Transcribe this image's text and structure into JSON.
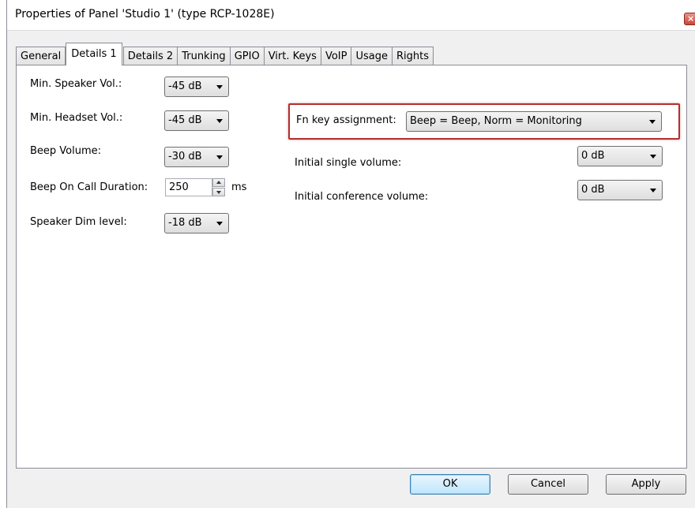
{
  "window": {
    "title": "Properties of Panel 'Studio 1' (type RCP-1028E)",
    "close_icon": "close-icon",
    "accent": "#c8473b"
  },
  "tabs": [
    {
      "label": "General",
      "active": false
    },
    {
      "label": "Details 1",
      "active": true
    },
    {
      "label": "Details 2",
      "active": false
    },
    {
      "label": "Trunking",
      "active": false
    },
    {
      "label": "GPIO",
      "active": false
    },
    {
      "label": "Virt. Keys",
      "active": false
    },
    {
      "label": "VoIP",
      "active": false
    },
    {
      "label": "Usage",
      "active": false
    },
    {
      "label": "Rights",
      "active": false
    }
  ],
  "left": {
    "min_speaker_vol": {
      "label": "Min. Speaker Vol.:",
      "value": "-45 dB"
    },
    "min_headset_vol": {
      "label": "Min. Headset Vol.:",
      "value": "-45 dB"
    },
    "beep_volume": {
      "label": "Beep Volume:",
      "value": "-30 dB"
    },
    "beep_on_call": {
      "label": "Beep On Call Duration:",
      "value": "250",
      "unit": "ms"
    },
    "speaker_dim": {
      "label": "Speaker Dim level:",
      "value": "-18 dB"
    }
  },
  "right": {
    "fn_key": {
      "label": "Fn key assignment:",
      "value": "Beep = Beep, Norm = Monitoring",
      "highlight_color": "#b72d2d"
    },
    "initial_single": {
      "label": "Initial single volume:",
      "value": "0 dB"
    },
    "initial_conference": {
      "label": "Initial conference volume:",
      "value": "0 dB"
    }
  },
  "buttons": {
    "ok": "OK",
    "cancel": "Cancel",
    "apply": "Apply"
  }
}
